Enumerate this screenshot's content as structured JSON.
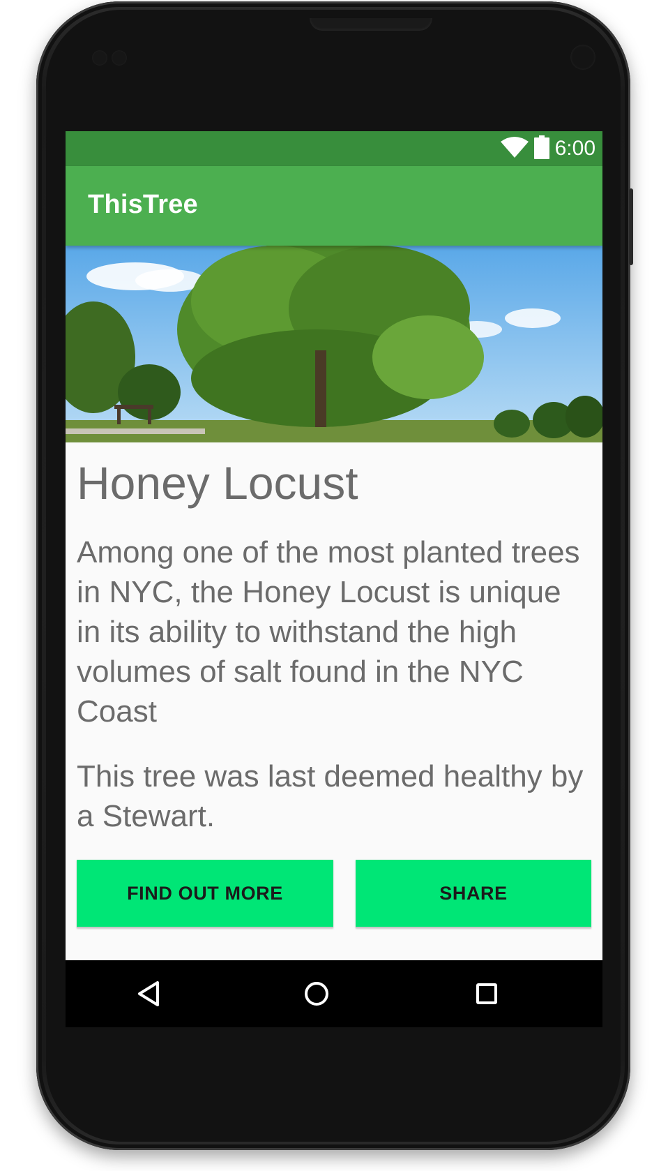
{
  "status_bar": {
    "time": "6:00",
    "icons": [
      "wifi-icon",
      "battery-icon"
    ]
  },
  "app_bar": {
    "title": "ThisTree"
  },
  "tree": {
    "name": "Honey Locust",
    "description": "Among one of the most planted trees in NYC, the Honey Locust is unique in its ability to withstand the high volumes of salt found in the NYC Coast",
    "health_note": "This tree was last deemed healthy by a Stewart."
  },
  "actions": {
    "find_out_more": "FIND OUT MORE",
    "share": "SHARE"
  },
  "nav_bar": {
    "icons": [
      "back-icon",
      "home-icon",
      "recents-icon"
    ]
  },
  "colors": {
    "status_bar": "#388e3c",
    "app_bar": "#4caf50",
    "button": "#00e676",
    "text": "#6b6b6b",
    "background": "#fafafa"
  }
}
